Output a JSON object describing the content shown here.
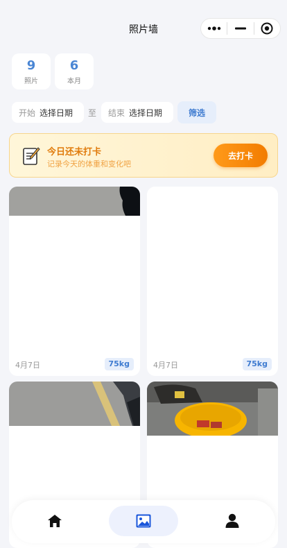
{
  "nav": {
    "title": "照片墙"
  },
  "stats": [
    {
      "value": "9",
      "label": "照片"
    },
    {
      "value": "6",
      "label": "本月"
    }
  ],
  "filter": {
    "start_key": "开始",
    "start_value": "选择日期",
    "separator": "至",
    "end_key": "结束",
    "end_value": "选择日期",
    "button_label": "筛选"
  },
  "banner": {
    "title": "今日还未打卡",
    "subtitle": "记录今天的体重和变化吧",
    "button_label": "去打卡",
    "icon": "memo-icon"
  },
  "photos": [
    {
      "date": "4月7日",
      "weight": "75kg"
    },
    {
      "date": "4月7日",
      "weight": "75kg"
    },
    {
      "date": "",
      "weight": ""
    },
    {
      "date": "",
      "weight": ""
    }
  ],
  "tabbar": {
    "items": [
      {
        "icon": "home-icon",
        "active": false
      },
      {
        "icon": "image-icon",
        "active": true
      },
      {
        "icon": "user-icon",
        "active": false
      }
    ]
  },
  "colors": {
    "accent": "#4a86d4",
    "warning": "#f27c00",
    "background": "#f4f5f9"
  }
}
